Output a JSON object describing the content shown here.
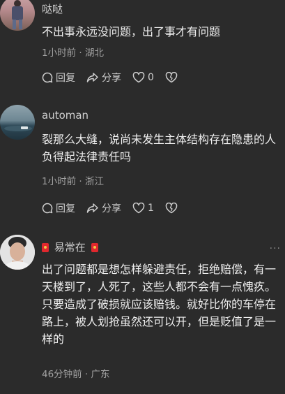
{
  "comments": [
    {
      "name": "哒哒",
      "text": "不出事永远没问题，出了事才有问题",
      "meta": "1小时前 · 湖北",
      "reply_label": "回复",
      "share_label": "分享",
      "likes": "0"
    },
    {
      "name": "automan",
      "text": "裂那么大缝，说尚未发生主体结构存在隐患的人负得起法律责任吗",
      "meta": "1小时前 · 浙江",
      "reply_label": "回复",
      "share_label": "分享",
      "likes": "1"
    },
    {
      "name": "易常在",
      "text": "出了问题都是想怎样躲避责任，拒绝赔偿，有一天楼到了，人死了，这些人都不会有一点愧疚。只要造成了破损就应该赔钱。就好比你的车停在路上，被人划抢虽然还可以开，但是贬值了是一样的",
      "meta": "46分钟前 · 广东"
    }
  ],
  "more_glyph": "···"
}
